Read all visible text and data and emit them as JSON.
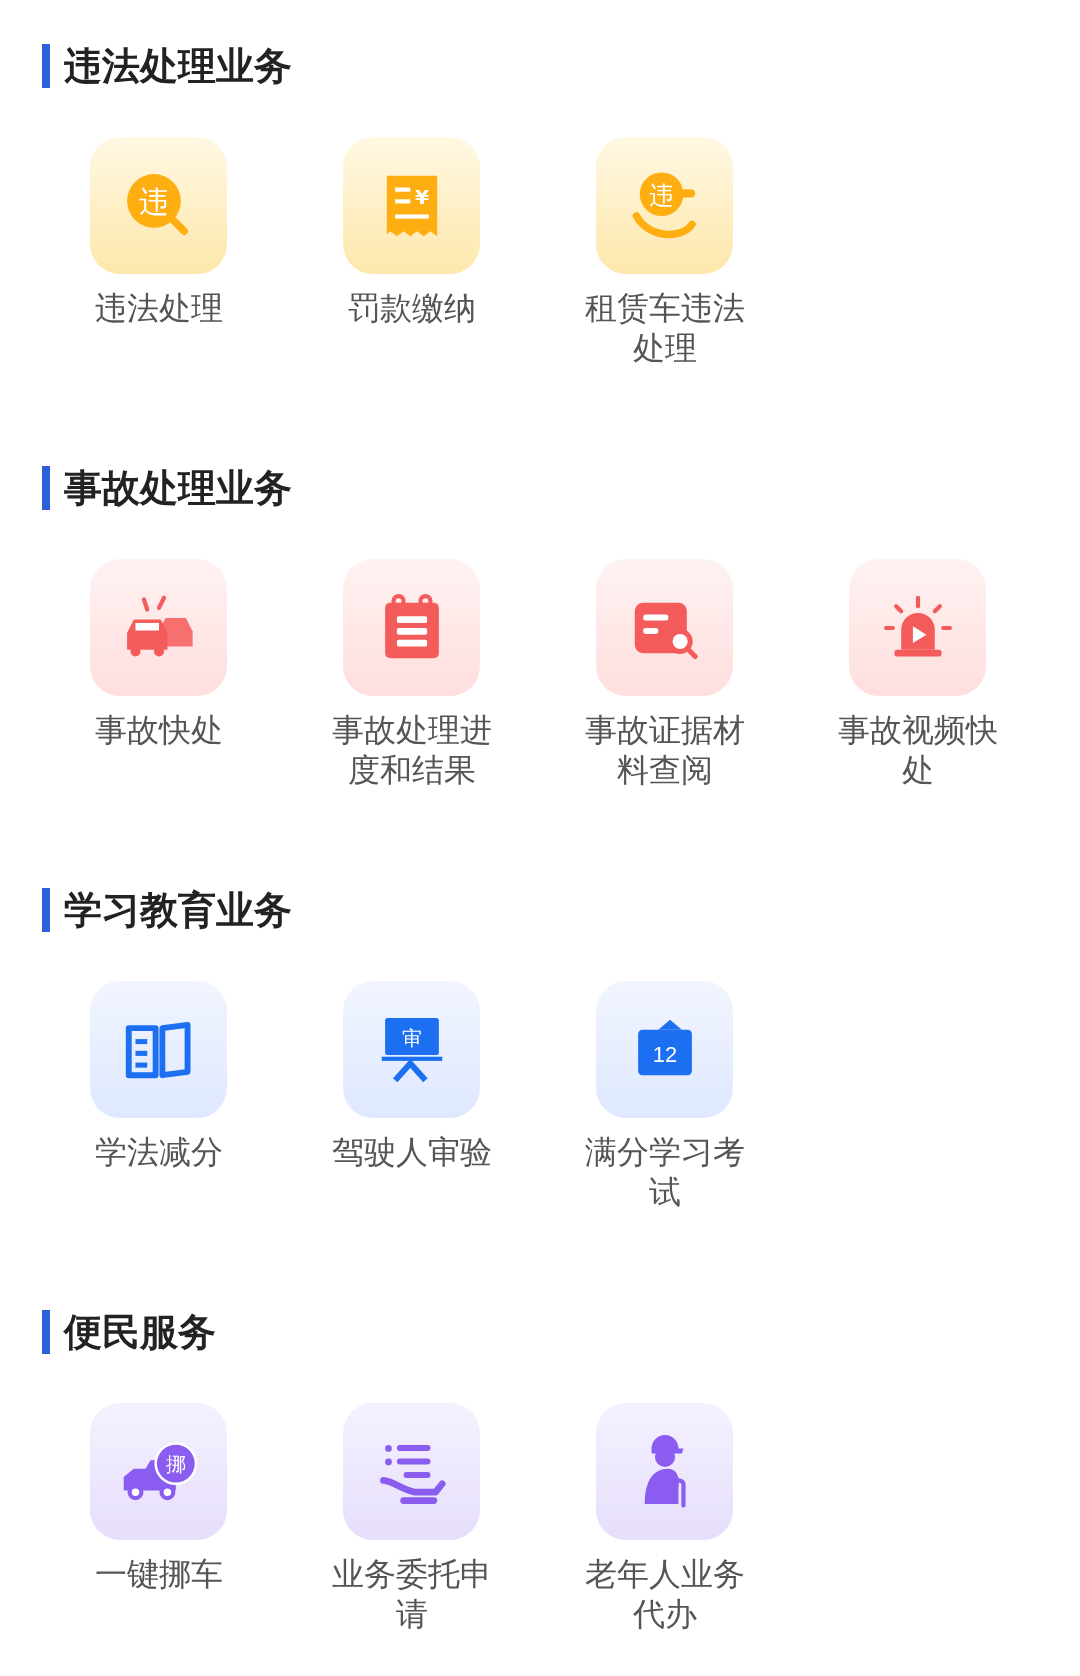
{
  "sections": [
    {
      "title": "违法处理业务",
      "items": [
        {
          "label": "违法处理",
          "glyph": "违"
        },
        {
          "label": "罚款缴纳",
          "glyph": "¥"
        },
        {
          "label": "租赁车违法处理",
          "glyph": "违"
        }
      ]
    },
    {
      "title": "事故处理业务",
      "items": [
        {
          "label": "事故快处"
        },
        {
          "label": "事故处理进度和结果"
        },
        {
          "label": "事故证据材料查阅"
        },
        {
          "label": "事故视频快处"
        }
      ]
    },
    {
      "title": "学习教育业务",
      "items": [
        {
          "label": "学法减分"
        },
        {
          "label": "驾驶人审验",
          "glyph": "审"
        },
        {
          "label": "满分学习考试",
          "glyph": "12"
        }
      ]
    },
    {
      "title": "便民服务",
      "items": [
        {
          "label": "一键挪车",
          "glyph": "挪"
        },
        {
          "label": "业务委托申请"
        },
        {
          "label": "老年人业务代办"
        }
      ]
    }
  ]
}
